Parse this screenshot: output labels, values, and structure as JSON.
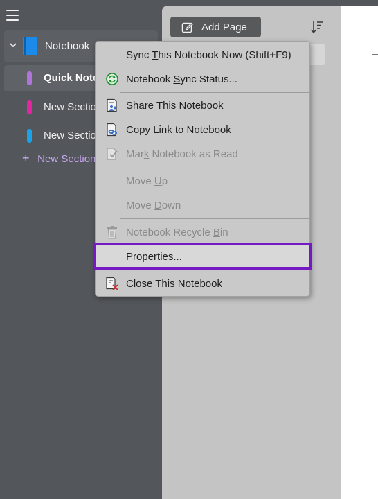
{
  "nav": {
    "notebook": {
      "name": "Notebook",
      "color": "#1c8ae8"
    },
    "sections": [
      {
        "label": "Quick Note",
        "color": "#b075d8",
        "selected": true
      },
      {
        "label": "New Section",
        "color": "#e0279f",
        "selected": false
      },
      {
        "label": "New Section",
        "color": "#1aa3e8",
        "selected": false
      }
    ],
    "add_section": {
      "label": "New Section",
      "color": "#c7a8f0"
    }
  },
  "pages_pane": {
    "add_page_label": "Add Page",
    "icons": {
      "add_page": "edit-icon",
      "sort": "sort-descending-icon"
    }
  },
  "menu": {
    "items": [
      {
        "id": "sync-now",
        "pre": "Sync ",
        "u": "T",
        "post": "his Notebook Now  (Shift+F9)",
        "icon": "",
        "disabled": false
      },
      {
        "id": "sync-status",
        "pre": "Notebook ",
        "u": "S",
        "post": "ync Status...",
        "icon": "sync-status-icon",
        "disabled": false
      },
      {
        "id": "share",
        "pre": "Share ",
        "u": "T",
        "post": "his Notebook",
        "icon": "share-notebook-icon",
        "disabled": false
      },
      {
        "id": "copy-link",
        "pre": "Copy ",
        "u": "L",
        "post": "ink to Notebook",
        "icon": "copy-link-icon",
        "disabled": false
      },
      {
        "id": "mark-read",
        "pre": "Mar",
        "u": "k",
        "post": " Notebook as Read",
        "icon": "mark-read-icon",
        "disabled": true
      },
      {
        "id": "move-up",
        "pre": "Move ",
        "u": "U",
        "post": "p",
        "icon": "",
        "disabled": true
      },
      {
        "id": "move-down",
        "pre": "Move ",
        "u": "D",
        "post": "own",
        "icon": "",
        "disabled": true
      },
      {
        "id": "recycle-bin",
        "pre": "Notebook Recycle ",
        "u": "B",
        "post": "in",
        "icon": "recycle-bin-icon",
        "disabled": true
      },
      {
        "id": "properties",
        "pre": "",
        "u": "P",
        "post": "roperties...",
        "icon": "",
        "disabled": false,
        "highlighted": true
      },
      {
        "id": "close",
        "pre": "",
        "u": "C",
        "post": "lose This Notebook",
        "icon": "close-notebook-icon",
        "disabled": false
      }
    ],
    "highlight_color": "#7519c2"
  }
}
